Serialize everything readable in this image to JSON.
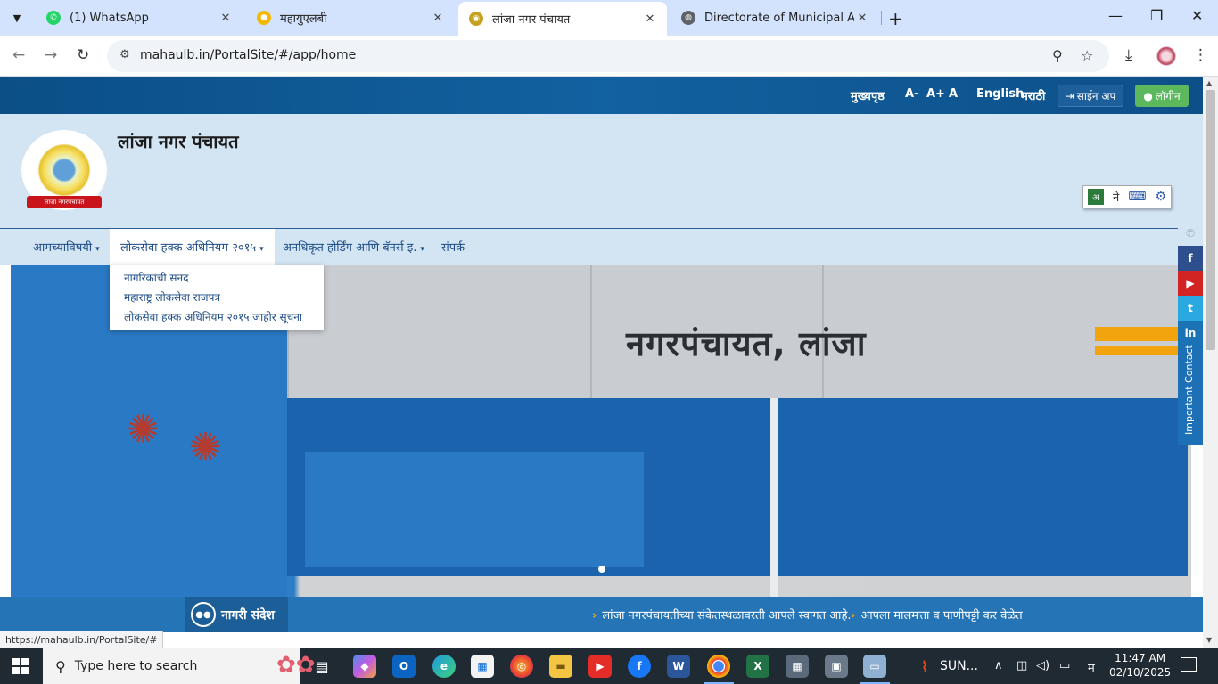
{
  "browser": {
    "tabs": [
      {
        "title": "(1) WhatsApp",
        "favicon": "whatsapp-icon",
        "active": false
      },
      {
        "title": "महायुएलबी",
        "favicon": "mahaulb-icon",
        "active": false
      },
      {
        "title": "लांजा नगर पंचायत",
        "favicon": "lanja-icon",
        "active": true
      },
      {
        "title": "Directorate of Municipal Admin",
        "favicon": "globe-icon",
        "active": false
      }
    ],
    "url": "mahaulb.in/PortalSite/#/app/home",
    "status_url": "https://mahaulb.in/PortalSite/#"
  },
  "topbar": {
    "home": "मुख्यपृष्ठ",
    "font_minus": "A-",
    "font_plus": "A+",
    "font_normal": "A",
    "english": "English",
    "marathi": "मराठी",
    "signup": "साईन अप",
    "login": "लॉगीन"
  },
  "header": {
    "site_title": "लांजा नगर पंचायत",
    "logo_ribbon": "लांजा नगरपंचायत",
    "lang_tool_char": "ने"
  },
  "nav": {
    "items": [
      {
        "label": "आमच्याविषयी"
      },
      {
        "label": "लोकसेवा हक्क अधिनियम २०१५"
      },
      {
        "label": "अनधिकृत होर्डिंग आणि बॅनर्स इ."
      },
      {
        "label": "संपर्क"
      }
    ],
    "dropdown": [
      "नागरिकांची सनद",
      "महाराष्ट्र लोकसेवा राजपत्र",
      "लोकसेवा हक्क अधिनियम २०१५ जाहीर सूचना"
    ]
  },
  "banner": {
    "building_text": "नगरपंचायत, लांजा"
  },
  "sidebar": {
    "important_contact": "Important Contact"
  },
  "ticker": {
    "label": "नागरी संदेश",
    "messages": [
      "लांजा नगरपंचायतीच्या संकेतस्थळावरती आपले स्वागत आहे.",
      "आपला मालमत्ता व पाणीपट्टी कर वेळेत"
    ]
  },
  "taskbar": {
    "search_placeholder": "Type here to search",
    "app_label": "SUN...",
    "ime": "म",
    "time": "11:47 AM",
    "date": "02/10/2025"
  },
  "colors": {
    "top_strip": "#0b4f86",
    "header_bg": "#d3e4f3",
    "nav_text": "#1c4c86",
    "login_green": "#5cb85c",
    "ticker_bg": "#2574b6",
    "accent_orange": "#f2a40f"
  }
}
